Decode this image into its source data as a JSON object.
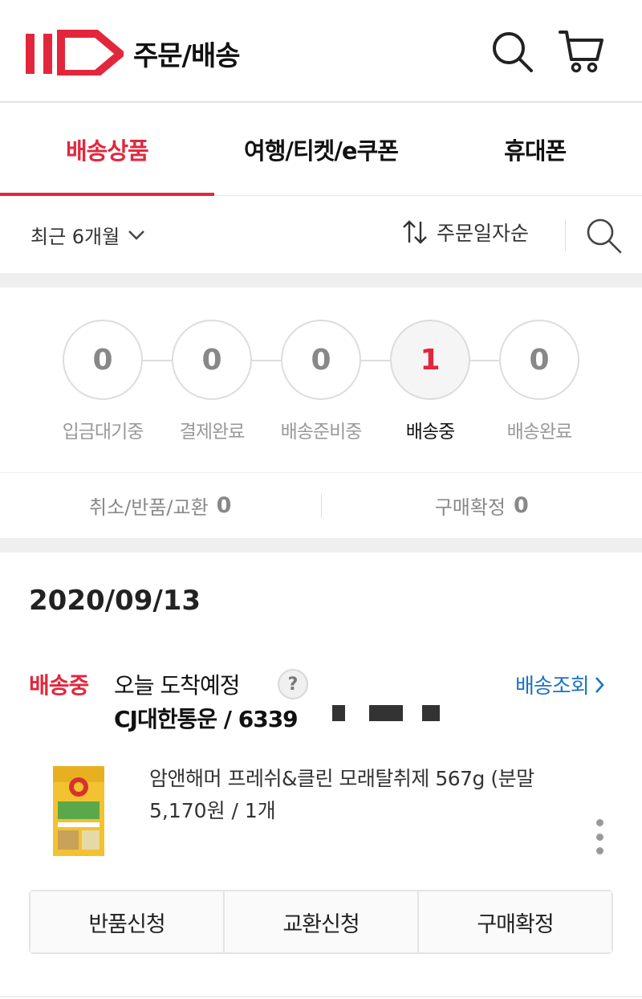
{
  "header": {
    "logo_text": "11",
    "title": "주문/배송",
    "icons": [
      "search-icon",
      "cart-icon"
    ]
  },
  "tabs": [
    {
      "label": "배송상품",
      "active": true
    },
    {
      "label": "여행/티켓/e쿠폰",
      "active": false
    },
    {
      "label": "휴대폰",
      "active": false
    }
  ],
  "filter": {
    "period": "최근 6개월",
    "sort": "주문일자순"
  },
  "steps": [
    {
      "count": "0",
      "label": "입금대기중",
      "current": false
    },
    {
      "count": "0",
      "label": "결제완료",
      "current": false
    },
    {
      "count": "0",
      "label": "배송준비중",
      "current": false
    },
    {
      "count": "1",
      "label": "배송중",
      "current": true
    },
    {
      "count": "0",
      "label": "배송완료",
      "current": false
    }
  ],
  "summary": {
    "cancel_label": "취소/반품/교환",
    "cancel_count": "0",
    "confirm_label": "구매확정",
    "confirm_count": "0"
  },
  "order": {
    "date": "2020/09/13",
    "status": "배송중",
    "arrival": "오늘 도착예정",
    "help": "?",
    "tracking_link": "배송조회",
    "carrier": "CJ대한통운 / 6339",
    "product_name": "암앤해머 프레쉬&클린 모래탈취제 567g (분말",
    "product_price": "5,170원 / 1개",
    "actions": [
      "반품신청",
      "교환신청",
      "구매확정"
    ]
  },
  "colors": {
    "accent": "#e2273c",
    "link": "#1a73c8"
  }
}
